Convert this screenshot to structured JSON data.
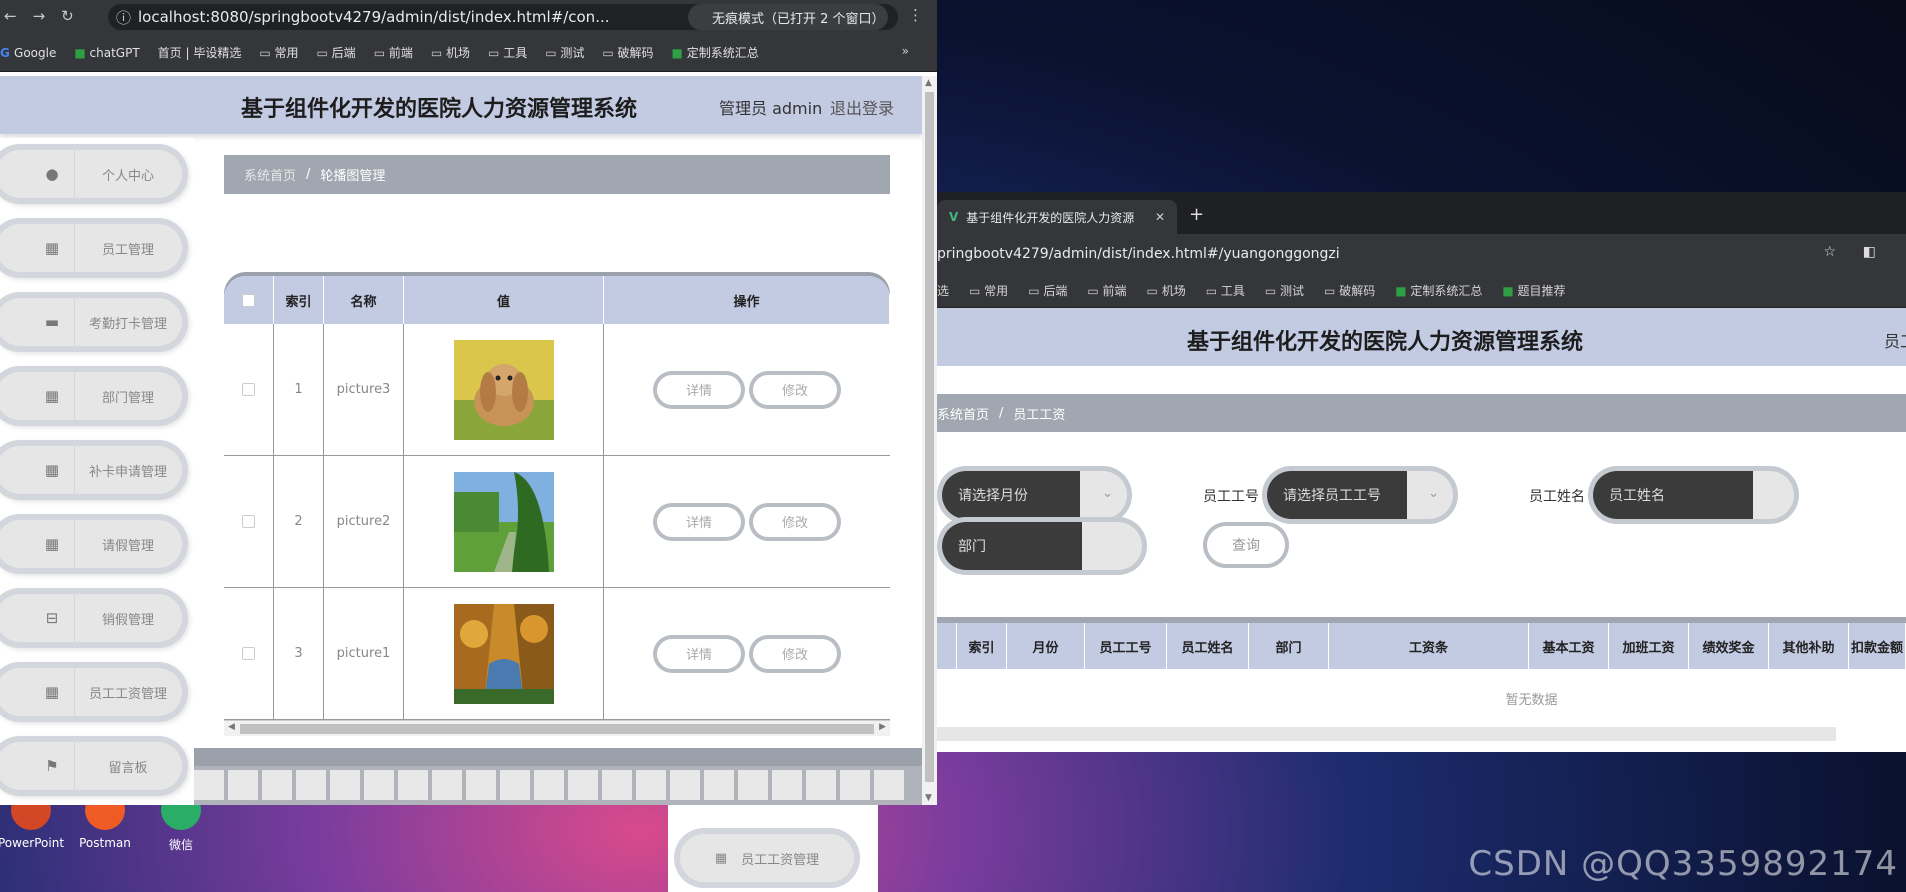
{
  "desktop": {
    "icons": [
      {
        "label": "PowerPoint",
        "color": "#d24726"
      },
      {
        "label": "Postman",
        "color": "#ef5b25"
      },
      {
        "label": "微信",
        "color": "#2aae67"
      }
    ],
    "watermark": "CSDN @QQ3359892174"
  },
  "left_window": {
    "url": "localhost:8080/springbootv4279/admin/dist/index.html#/con...",
    "incognito": "无痕模式（已打开 2 个窗口）",
    "bookmarks": [
      "Google",
      "chatGPT",
      "首页 | 毕设精选",
      "常用",
      "后端",
      "前端",
      "机场",
      "工具",
      "测试",
      "破解码",
      "定制系统汇总"
    ],
    "more": "»",
    "app_title": "基于组件化开发的医院人力资源管理系统",
    "user": "管理员 admin",
    "logout": "退出登录",
    "sidebar": [
      {
        "label": "个人中心",
        "icon": "user-icon",
        "glyph": "👤"
      },
      {
        "label": "员工管理",
        "icon": "grid-icon",
        "glyph": "▦"
      },
      {
        "label": "考勤打卡管理",
        "icon": "card-icon",
        "glyph": "▬"
      },
      {
        "label": "部门管理",
        "icon": "grid-icon",
        "glyph": "▦"
      },
      {
        "label": "补卡申请管理",
        "icon": "grid-icon",
        "glyph": "▦"
      },
      {
        "label": "请假管理",
        "icon": "grid-icon",
        "glyph": "▦"
      },
      {
        "label": "销假管理",
        "icon": "briefcase-icon",
        "glyph": "⊟"
      },
      {
        "label": "员工工资管理",
        "icon": "grid-icon",
        "glyph": "▦"
      },
      {
        "label": "留言板",
        "icon": "flag-icon",
        "glyph": "⚑"
      }
    ],
    "breadcrumb": {
      "home": "系统首页",
      "current": "轮播图管理"
    },
    "table": {
      "headers": [
        "",
        "索引",
        "名称",
        "值",
        "操作"
      ],
      "rows": [
        {
          "index": "1",
          "name": "picture3",
          "image": "rabbit"
        },
        {
          "index": "2",
          "name": "picture2",
          "image": "willow-path"
        },
        {
          "index": "3",
          "name": "picture1",
          "image": "autumn-forest"
        }
      ],
      "detail_label": "详情",
      "edit_label": "修改"
    }
  },
  "right_window": {
    "tab_title": "基于组件化开发的医院人力资源",
    "url": "pringbootv4279/admin/dist/index.html#/yuangonggongzi",
    "bookmarks": [
      "选",
      "常用",
      "后端",
      "前端",
      "机场",
      "工具",
      "测试",
      "破解码",
      "定制系统汇总",
      "题目推荐"
    ],
    "app_title": "基于组件化开发的医院人力资源管理系统",
    "user_partial": "员工",
    "breadcrumb": {
      "home": "系统首页",
      "current": "员工工资"
    },
    "filters": {
      "month_placeholder": "请选择月份",
      "empno_label": "员工工号",
      "empno_placeholder": "请选择员工工号",
      "name_label": "员工姓名",
      "name_placeholder": "员工姓名",
      "dept_placeholder": "部门",
      "query_label": "查询"
    },
    "table": {
      "headers": [
        "索引",
        "月份",
        "员工工号",
        "员工姓名",
        "部门",
        "工资条",
        "基本工资",
        "加班工资",
        "绩效奖金",
        "其他补助",
        "扣款金额"
      ],
      "empty": "暂无数据"
    }
  },
  "behind_sidebar_item": "员工工资管理"
}
